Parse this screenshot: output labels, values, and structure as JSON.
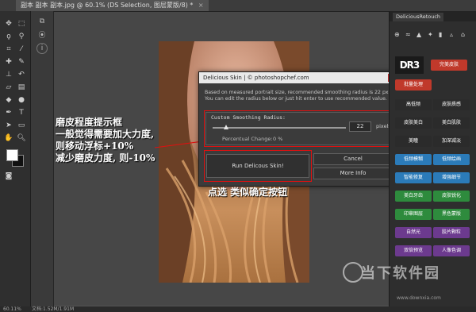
{
  "document_tab": {
    "title": "副本 副本 副本.jpg @ 60.1% (DS Selection, 图层蒙版/8) *",
    "close": "×"
  },
  "dialog": {
    "title": "Delicious Skin | © photoshopchef.com",
    "close": "×",
    "info_line1": "Based on measured portrait size, recommended smoothing radius is 22 px.",
    "info_line2": "You can edit the radius below or just hit enter to use recommended value.",
    "radius_label": "Custom Smoothing Radius:",
    "radius_value": "22",
    "radius_unit": "pixels",
    "radius_slider_fraction": 0.1,
    "percentual_change_label": "Percentual Change:",
    "percentual_change_value": "0 %",
    "run_button": "Run Delicous Skin!",
    "cancel_button": "Cancel",
    "more_info_button": "More Info"
  },
  "annotations": {
    "left_line1": "磨皮程度提示框",
    "left_line2": "一般觉得需要加大力度,",
    "left_line3": "则移动浮标+10%",
    "left_line4": "减少磨皮力度, 则-10%",
    "run_hint": "点选 类似确定按钮"
  },
  "right_panel": {
    "tab": "DeliciousRetouch",
    "logo": "DR3",
    "buttons": [
      {
        "label": "完美皮肤",
        "color": "#c0392b"
      },
      {
        "label": "批量处理",
        "color": "#c0392b"
      },
      {
        "label": "高低频",
        "color": "#2b2b2b"
      },
      {
        "label": "皮肤质感",
        "color": "#2b2b2b"
      },
      {
        "label": "皮肤美白",
        "color": "#2b2b2b"
      },
      {
        "label": "美白肌肤",
        "color": "#2b2b2b"
      },
      {
        "label": "美瞳",
        "color": "#2b2b2b"
      },
      {
        "label": "加深减淡",
        "color": "#2b2b2b"
      },
      {
        "label": "低频模糊",
        "color": "#2b7bb9"
      },
      {
        "label": "低频绘画",
        "color": "#2b7bb9"
      },
      {
        "label": "智能修复",
        "color": "#2b7bb9"
      },
      {
        "label": "增强细节",
        "color": "#2b7bb9"
      },
      {
        "label": "美白牙齿",
        "color": "#2e8b3d"
      },
      {
        "label": "皮肤锐化",
        "color": "#2e8b3d"
      },
      {
        "label": "印章图层",
        "color": "#2e8b3d"
      },
      {
        "label": "黑色蒙版",
        "color": "#2e8b3d"
      },
      {
        "label": "自然光",
        "color": "#6c3a8e"
      },
      {
        "label": "胶片颗粒",
        "color": "#6c3a8e"
      },
      {
        "label": "双倍预览",
        "color": "#6c3a8e"
      },
      {
        "label": "人像色调",
        "color": "#6c3a8e"
      }
    ]
  },
  "status": {
    "zoom": "60.11%",
    "doc": "文档:1.52M/1.91M"
  },
  "watermark": {
    "text": "当下软件园",
    "sub": "www.downxia.com"
  },
  "colors": {
    "red_highlight": "#e01010",
    "dialog_bg": "#3b3b3b"
  }
}
